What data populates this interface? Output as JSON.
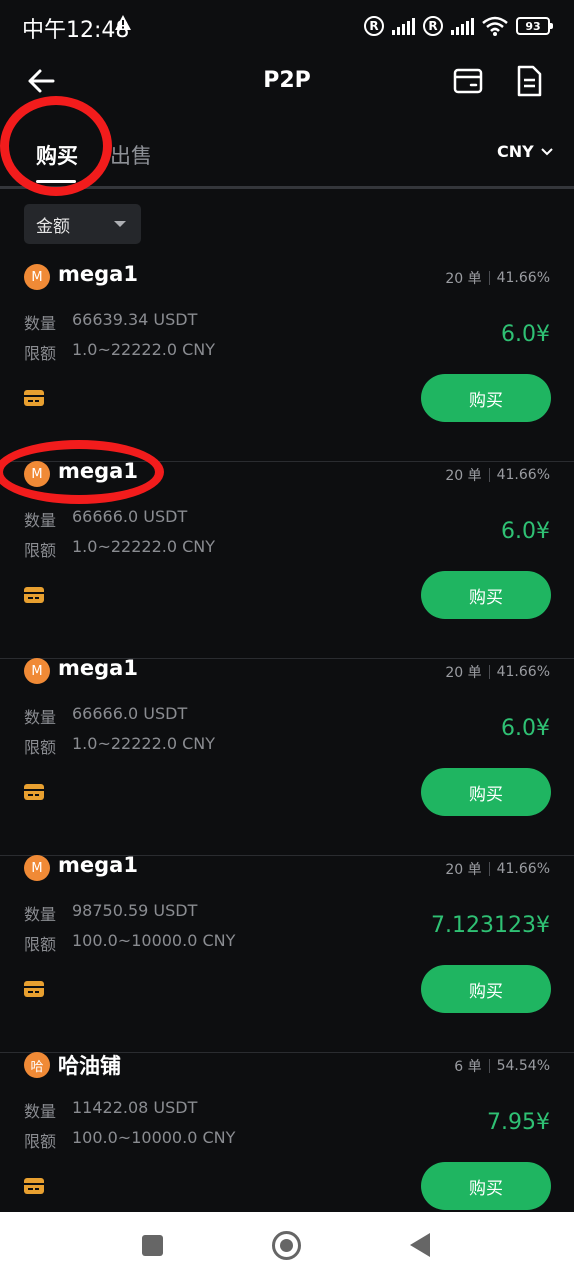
{
  "status_bar": {
    "time": "中午12:48",
    "registered_mark": "R",
    "battery_level": "93"
  },
  "header": {
    "title": "P2P"
  },
  "tabs": {
    "buy_label": "购买",
    "sell_label": "出售"
  },
  "currency": {
    "selected": "CNY"
  },
  "filter": {
    "label": "金额"
  },
  "offers": [
    {
      "avatar_letter": "M",
      "name": "mega1",
      "orders": "20 单",
      "completion": "41.66%",
      "quantity_label": "数量",
      "quantity": "66639.34 USDT",
      "limit_label": "限额",
      "limit": "1.0~22222.0 CNY",
      "price": "6.0¥",
      "button_label": "购买"
    },
    {
      "avatar_letter": "M",
      "name": "mega1",
      "orders": "20 单",
      "completion": "41.66%",
      "quantity_label": "数量",
      "quantity": "66666.0 USDT",
      "limit_label": "限额",
      "limit": "1.0~22222.0 CNY",
      "price": "6.0¥",
      "button_label": "购买"
    },
    {
      "avatar_letter": "M",
      "name": "mega1",
      "orders": "20 单",
      "completion": "41.66%",
      "quantity_label": "数量",
      "quantity": "66666.0 USDT",
      "limit_label": "限额",
      "limit": "1.0~22222.0 CNY",
      "price": "6.0¥",
      "button_label": "购买"
    },
    {
      "avatar_letter": "M",
      "name": "mega1",
      "orders": "20 单",
      "completion": "41.66%",
      "quantity_label": "数量",
      "quantity": "98750.59 USDT",
      "limit_label": "限额",
      "limit": "100.0~10000.0 CNY",
      "price": "7.123123¥",
      "button_label": "购买"
    },
    {
      "avatar_letter": "哈",
      "name": "哈油铺",
      "orders": "6 单",
      "completion": "54.54%",
      "quantity_label": "数量",
      "quantity": "11422.08 USDT",
      "limit_label": "限额",
      "limit": "100.0~10000.0 CNY",
      "price": "7.95¥",
      "button_label": "购买"
    }
  ],
  "icons": {
    "back": "arrow-left-icon",
    "wallet": "wallet-icon",
    "orders": "document-icon",
    "payment": "bank-card-icon"
  },
  "colors": {
    "accent_green": "#1fb561",
    "price_green": "#2fc174",
    "avatar_orange": "#f08a36",
    "annotation_red": "#f21c1c"
  }
}
